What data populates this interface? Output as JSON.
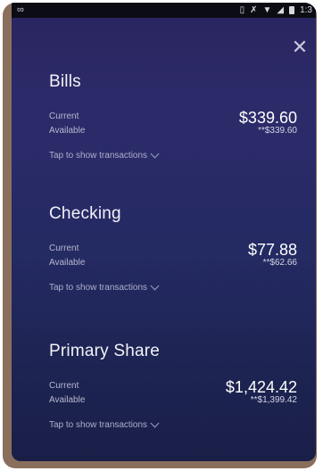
{
  "status_bar": {
    "left_icon": "link-icon",
    "right_text": "1:3"
  },
  "close_label": "✕",
  "accounts": [
    {
      "name": "Bills",
      "current_label": "Current",
      "current_value": "$339.60",
      "available_label": "Available",
      "available_value": "**$339.60",
      "tap_label": "Tap to show transactions"
    },
    {
      "name": "Checking",
      "current_label": "Current",
      "current_value": "$77.88",
      "available_label": "Available",
      "available_value": "**$62.66",
      "tap_label": "Tap to show transactions"
    },
    {
      "name": "Primary Share",
      "current_label": "Current",
      "current_value": "$1,424.42",
      "available_label": "Available",
      "available_value": "**$1,399.42",
      "tap_label": "Tap to show transactions"
    }
  ],
  "colors": {
    "frame": "#8a6f5c",
    "screen_top": "#2a2560",
    "screen_bottom": "#1a1f48",
    "status_bar": "#0c0c14"
  }
}
